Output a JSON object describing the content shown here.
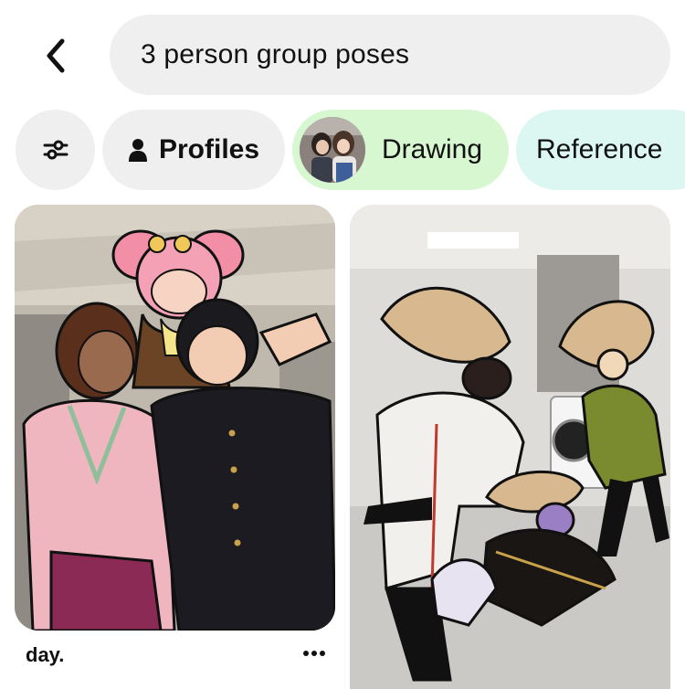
{
  "search": {
    "query": "3 person group poses"
  },
  "chips": {
    "filter_icon": "sliders-icon",
    "profiles_label": "Profiles",
    "drawing_label": "Drawing",
    "reference_label": "Reference",
    "colors": {
      "neutral": "#efefef",
      "drawing": "#d6f7d0",
      "reference": "#dcf7f2"
    }
  },
  "pins": [
    {
      "caption": "day.",
      "menu_icon": "more-icon"
    },
    {
      "caption": ""
    }
  ]
}
